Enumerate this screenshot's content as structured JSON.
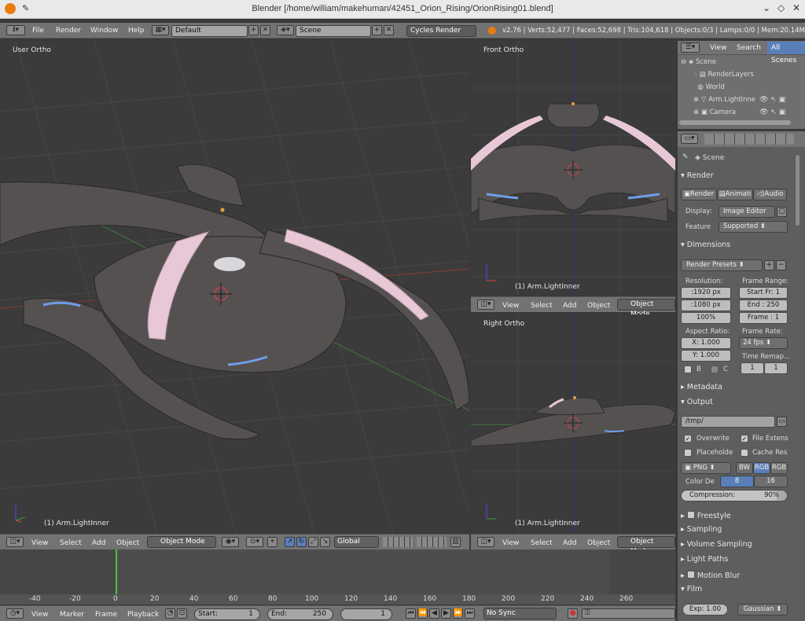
{
  "window": {
    "title": "Blender [/home/william/makehuman/42451_Orion_Rising/OrionRising01.blend]"
  },
  "topbar": {
    "menus": [
      "File",
      "Render",
      "Window",
      "Help"
    ],
    "layout": "Default",
    "scene": "Scene",
    "engine": "Cycles Render",
    "stats": "v2.76 | Verts:52,477 | Faces:52,698 | Tris:104,618 | Objects:0/3 | Lamps:0/0 | Mem:20.14M"
  },
  "viewports": {
    "main": {
      "label": "User Ortho",
      "object": "(1) Arm.LightInner"
    },
    "front": {
      "label": "Front Ortho",
      "object": "(1) Arm.LightInner"
    },
    "right": {
      "label": "Right Ortho",
      "object": "(1) Arm.LightInner"
    }
  },
  "header3d": {
    "menus": [
      "View",
      "Select",
      "Add",
      "Object"
    ],
    "mode": "Object Mode",
    "orientation": "Global"
  },
  "outliner": {
    "tabs": [
      "View",
      "Search",
      "All Scenes"
    ],
    "items": [
      "Scene",
      "RenderLayers",
      "World",
      "Arm.LightInne",
      "Camera"
    ]
  },
  "properties": {
    "context": "Scene",
    "render": {
      "title": "Render",
      "buttons": [
        "Render",
        "Animati",
        "Audio"
      ],
      "display_label": "Display:",
      "display": "Image Editor",
      "feature_label": "Feature",
      "feature": "Supported"
    },
    "dimensions": {
      "title": "Dimensions",
      "presets": "Render Presets",
      "resolution_label": "Resolution:",
      "res_x": ":1920 px",
      "res_y": ":1080 px",
      "res_pct": "100%",
      "frame_range_label": "Frame Range:",
      "start": "Start Fr: 1",
      "end": "End : 250",
      "frame": "Frame : 1",
      "aspect_label": "Aspect Ratio:",
      "asp_x": "X: 1.000",
      "asp_y": "Y: 1.000",
      "fps_label": "Frame Rate:",
      "fps": "24 fps",
      "remap_label": "Time Remap...",
      "remap_a": "1",
      "remap_b": "1",
      "border": "B",
      "crop": "C"
    },
    "metadata": "Metadata",
    "output": {
      "title": "Output",
      "path": "/tmp/",
      "overwrite": "Overwrite",
      "file_ext": "File Extens",
      "placeholders": "Placeholde",
      "cache": "Cache Res",
      "format": "PNG",
      "bw": "BW",
      "rgb": "RGB",
      "rgba": "RGB",
      "color_depth_label": "Color De",
      "depth8": "8",
      "depth16": "16",
      "compression_label": "Compression:",
      "compression_value": "90%",
      "compression": 0.9
    },
    "panels": [
      "Freestyle",
      "Sampling",
      "Volume Sampling",
      "Light Paths",
      "Motion Blur",
      "Film"
    ],
    "film": {
      "exposure": "Exp: 1.00",
      "filter": "Gaussian"
    }
  },
  "timeline": {
    "ticks": [
      "-40",
      "-20",
      "0",
      "20",
      "40",
      "60",
      "80",
      "100",
      "120",
      "140",
      "160",
      "180",
      "200",
      "220",
      "240",
      "260"
    ],
    "menus": [
      "View",
      "Marker",
      "Frame",
      "Playback"
    ],
    "start": "Start:",
    "start_val": "1",
    "end": "End:",
    "end_val": "250",
    "current": "1",
    "sync": "No Sync"
  }
}
